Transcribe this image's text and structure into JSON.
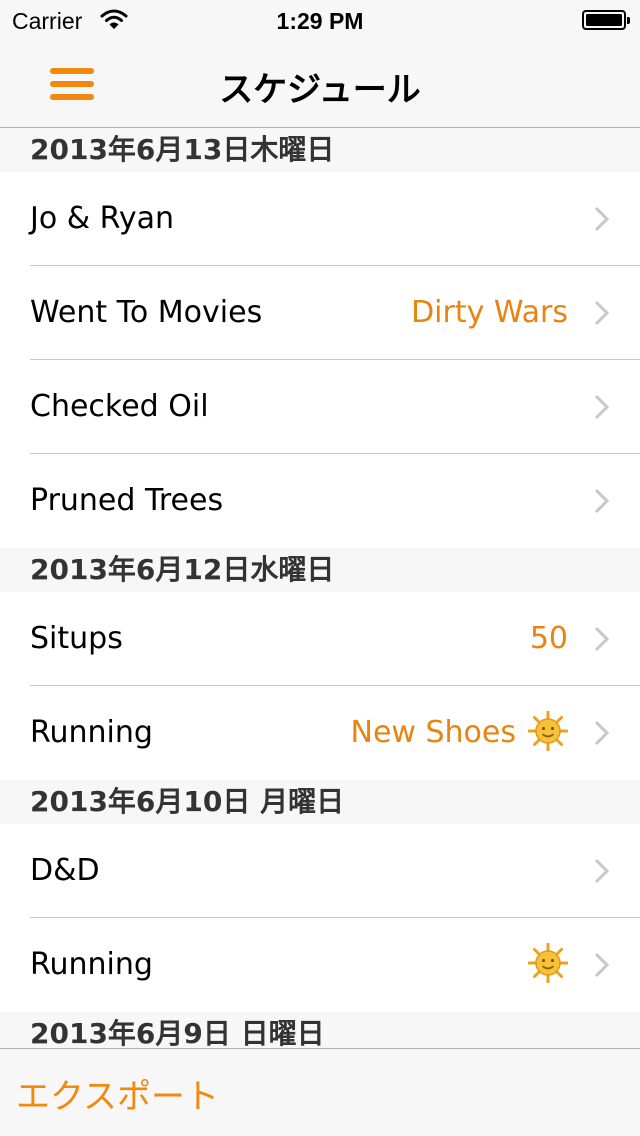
{
  "status_bar": {
    "carrier": "Carrier",
    "time": "1:29 PM"
  },
  "nav": {
    "title": "スケジュール",
    "menu_icon": "hamburger-menu-icon"
  },
  "sections": [
    {
      "header": "2013年6月13日木曜日",
      "rows": [
        {
          "title": "Jo & Ryan",
          "detail": ""
        },
        {
          "title": "Went To Movies",
          "detail": "Dirty Wars"
        },
        {
          "title": "Checked Oil",
          "detail": ""
        },
        {
          "title": "Pruned Trees",
          "detail": ""
        }
      ]
    },
    {
      "header": "2013年6月12日水曜日",
      "rows": [
        {
          "title": "Situps",
          "detail": "50"
        },
        {
          "title": "Running",
          "detail": "New Shoes",
          "icon": "sun-emoji-icon"
        }
      ]
    },
    {
      "header": "2013年6月10日 月曜日",
      "rows": [
        {
          "title": "D&D",
          "detail": ""
        },
        {
          "title": "Running",
          "detail": "",
          "icon": "sun-emoji-icon"
        }
      ]
    },
    {
      "header": "2013年6月9日 日曜日",
      "rows": []
    }
  ],
  "toolbar": {
    "export_label": "エクスポート"
  },
  "colors": {
    "accent": "#f0890d",
    "detail_text": "#e8840f",
    "section_background": "#f7f7f7",
    "separator": "#c8c7cc"
  }
}
